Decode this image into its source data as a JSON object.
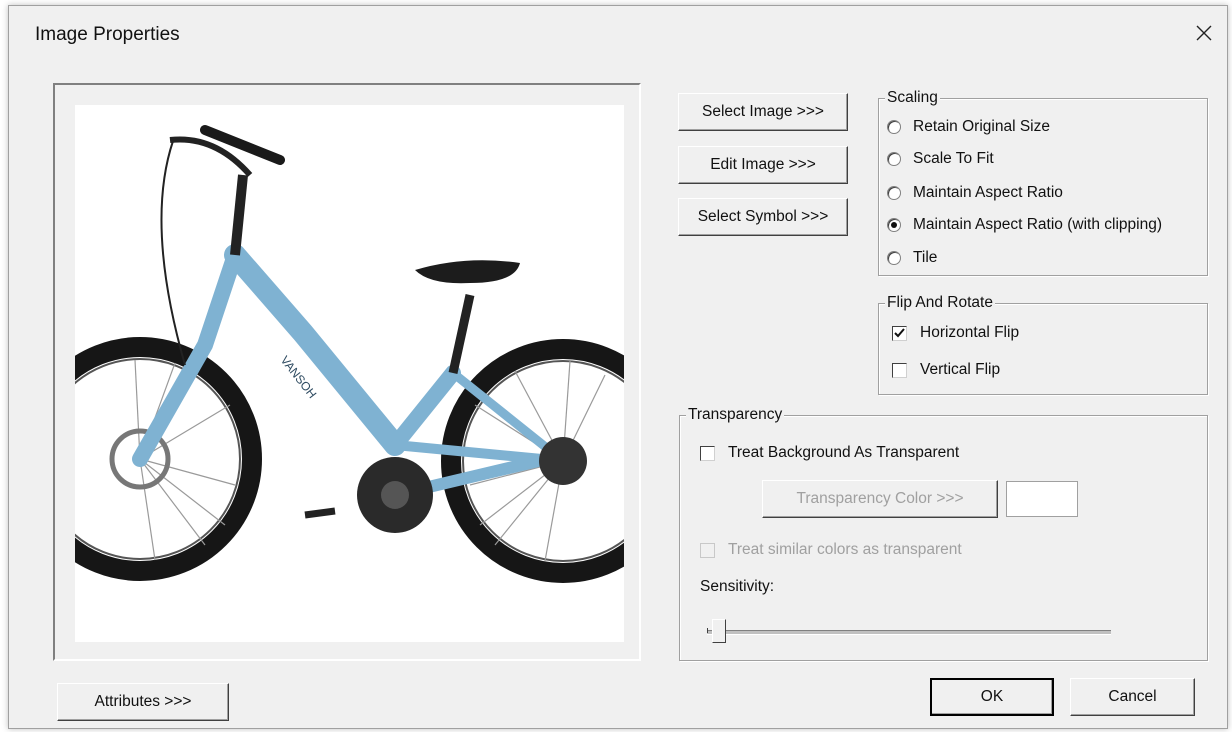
{
  "window": {
    "title": "Image Properties",
    "close_label": "✕"
  },
  "buttons": {
    "select_image": "Select Image >>>",
    "edit_image": "Edit Image >>>",
    "select_symbol": "Select Symbol >>>",
    "attributes": "Attributes >>>",
    "ok": "OK",
    "cancel": "Cancel"
  },
  "preview": {
    "image": "bicycle-image",
    "frame_text": "VANSOH"
  },
  "scaling": {
    "legend": "Scaling",
    "options": [
      {
        "label": "Retain Original Size",
        "checked": false
      },
      {
        "label": "Scale To Fit",
        "checked": false
      },
      {
        "label": "Maintain Aspect Ratio",
        "checked": false
      },
      {
        "label": "Maintain Aspect Ratio (with clipping)",
        "checked": true
      },
      {
        "label": "Tile",
        "checked": false
      }
    ]
  },
  "flip_rotate": {
    "legend": "Flip And Rotate",
    "horizontal_flip": {
      "label": "Horizontal Flip",
      "checked": true
    },
    "vertical_flip": {
      "label": "Vertical Flip",
      "checked": false
    }
  },
  "transparency": {
    "legend": "Transparency",
    "treat_background": {
      "label": "Treat Background As Transparent",
      "checked": false
    },
    "color_button": "Transparency Color >>>",
    "color_value": "#ffffff",
    "similar_colors": {
      "label": "Treat similar colors as transparent",
      "checked": false,
      "enabled": false
    },
    "sensitivity_label": "Sensitivity:",
    "sensitivity_value": 0.03
  }
}
